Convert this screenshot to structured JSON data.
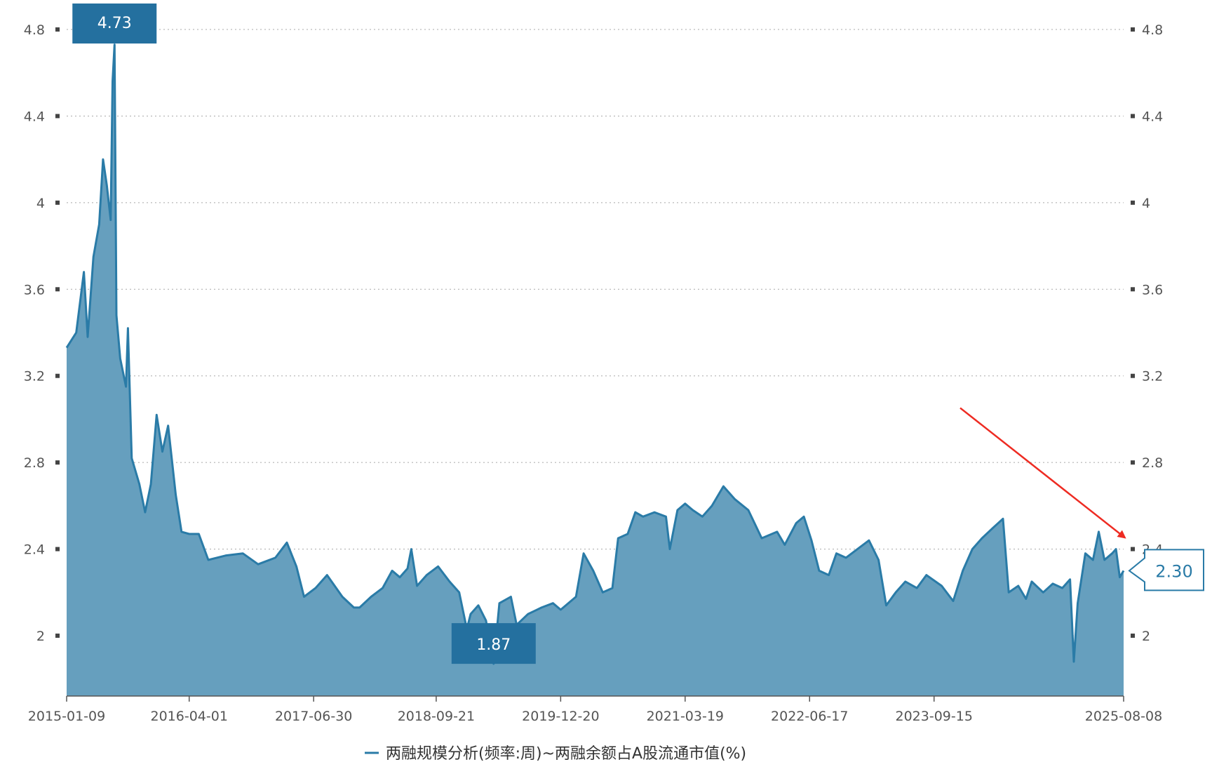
{
  "chart_data": {
    "type": "area",
    "title": "",
    "ylim": [
      1.72,
      4.85
    ],
    "y_ticks": [
      "2",
      "2.4",
      "2.8",
      "3.2",
      "3.6",
      "4",
      "4.4",
      "4.8"
    ],
    "x_tick_labels": [
      "2015-01-09",
      "2016-04-01",
      "2017-06-30",
      "2018-09-21",
      "2019-12-20",
      "2021-03-19",
      "2022-06-17",
      "2023-09-15",
      "2025-08-08"
    ],
    "grid": true,
    "dual_y_axis": true,
    "legend_position": "bottom-center",
    "series": [
      {
        "name": "两融规模分析(频率:周)~两融余额占A股流通市值(%)",
        "color": "#2a7ba7",
        "fill": "#669fbe",
        "points": [
          [
            "2015-01-09",
            3.33
          ],
          [
            "2015-02-13",
            3.4
          ],
          [
            "2015-03-13",
            3.68
          ],
          [
            "2015-03-27",
            3.38
          ],
          [
            "2015-04-17",
            3.75
          ],
          [
            "2015-05-08",
            3.9
          ],
          [
            "2015-05-22",
            4.2
          ],
          [
            "2015-06-05",
            4.08
          ],
          [
            "2015-06-19",
            3.92
          ],
          [
            "2015-06-26",
            4.56
          ],
          [
            "2015-07-03",
            4.73
          ],
          [
            "2015-07-10",
            3.48
          ],
          [
            "2015-07-24",
            3.28
          ],
          [
            "2015-08-14",
            3.15
          ],
          [
            "2015-08-21",
            3.42
          ],
          [
            "2015-09-04",
            2.82
          ],
          [
            "2015-10-02",
            2.7
          ],
          [
            "2015-10-23",
            2.57
          ],
          [
            "2015-11-13",
            2.7
          ],
          [
            "2015-12-04",
            3.02
          ],
          [
            "2015-12-25",
            2.85
          ],
          [
            "2016-01-15",
            2.97
          ],
          [
            "2016-02-12",
            2.65
          ],
          [
            "2016-03-04",
            2.48
          ],
          [
            "2016-04-01",
            2.47
          ],
          [
            "2016-05-06",
            2.47
          ],
          [
            "2016-06-10",
            2.35
          ],
          [
            "2016-08-12",
            2.37
          ],
          [
            "2016-10-14",
            2.38
          ],
          [
            "2016-12-09",
            2.33
          ],
          [
            "2017-02-10",
            2.36
          ],
          [
            "2017-03-24",
            2.43
          ],
          [
            "2017-04-28",
            2.32
          ],
          [
            "2017-05-26",
            2.18
          ],
          [
            "2017-07-07",
            2.22
          ],
          [
            "2017-08-18",
            2.28
          ],
          [
            "2017-10-13",
            2.18
          ],
          [
            "2017-11-24",
            2.13
          ],
          [
            "2017-12-15",
            2.13
          ],
          [
            "2018-01-26",
            2.18
          ],
          [
            "2018-03-09",
            2.22
          ],
          [
            "2018-04-13",
            2.3
          ],
          [
            "2018-05-11",
            2.27
          ],
          [
            "2018-06-08",
            2.31
          ],
          [
            "2018-06-22",
            2.4
          ],
          [
            "2018-07-13",
            2.23
          ],
          [
            "2018-08-17",
            2.28
          ],
          [
            "2018-09-28",
            2.32
          ],
          [
            "2018-11-09",
            2.25
          ],
          [
            "2018-12-14",
            2.2
          ],
          [
            "2019-01-11",
            2.03
          ],
          [
            "2019-01-25",
            2.1
          ],
          [
            "2019-02-22",
            2.14
          ],
          [
            "2019-03-22",
            2.07
          ],
          [
            "2019-04-19",
            1.87
          ],
          [
            "2019-05-10",
            2.15
          ],
          [
            "2019-06-21",
            2.18
          ],
          [
            "2019-07-12",
            2.05
          ],
          [
            "2019-08-23",
            2.1
          ],
          [
            "2019-10-11",
            2.13
          ],
          [
            "2019-11-22",
            2.15
          ],
          [
            "2019-12-20",
            2.12
          ],
          [
            "2020-02-14",
            2.18
          ],
          [
            "2020-03-13",
            2.38
          ],
          [
            "2020-04-17",
            2.3
          ],
          [
            "2020-05-22",
            2.2
          ],
          [
            "2020-06-26",
            2.22
          ],
          [
            "2020-07-17",
            2.45
          ],
          [
            "2020-08-21",
            2.47
          ],
          [
            "2020-09-18",
            2.57
          ],
          [
            "2020-10-16",
            2.55
          ],
          [
            "2020-11-27",
            2.57
          ],
          [
            "2021-01-08",
            2.55
          ],
          [
            "2021-01-22",
            2.4
          ],
          [
            "2021-02-19",
            2.58
          ],
          [
            "2021-03-19",
            2.61
          ],
          [
            "2021-04-16",
            2.58
          ],
          [
            "2021-05-21",
            2.55
          ],
          [
            "2021-06-25",
            2.6
          ],
          [
            "2021-08-06",
            2.69
          ],
          [
            "2021-09-17",
            2.63
          ],
          [
            "2021-11-05",
            2.58
          ],
          [
            "2021-12-24",
            2.45
          ],
          [
            "2022-02-18",
            2.48
          ],
          [
            "2022-03-18",
            2.42
          ],
          [
            "2022-04-29",
            2.52
          ],
          [
            "2022-05-27",
            2.55
          ],
          [
            "2022-06-24",
            2.44
          ],
          [
            "2022-07-22",
            2.3
          ],
          [
            "2022-08-26",
            2.28
          ],
          [
            "2022-09-23",
            2.38
          ],
          [
            "2022-10-28",
            2.36
          ],
          [
            "2022-12-09",
            2.4
          ],
          [
            "2023-01-20",
            2.44
          ],
          [
            "2023-02-24",
            2.35
          ],
          [
            "2023-03-24",
            2.14
          ],
          [
            "2023-04-28",
            2.2
          ],
          [
            "2023-06-02",
            2.25
          ],
          [
            "2023-07-14",
            2.22
          ],
          [
            "2023-08-18",
            2.28
          ],
          [
            "2023-10-13",
            2.23
          ],
          [
            "2023-11-24",
            2.16
          ],
          [
            "2023-12-29",
            2.3
          ],
          [
            "2024-02-02",
            2.4
          ],
          [
            "2024-03-08",
            2.45
          ],
          [
            "2024-04-19",
            2.5
          ],
          [
            "2024-05-24",
            2.54
          ],
          [
            "2024-06-14",
            2.2
          ],
          [
            "2024-07-19",
            2.23
          ],
          [
            "2024-08-16",
            2.17
          ],
          [
            "2024-09-06",
            2.25
          ],
          [
            "2024-10-18",
            2.2
          ],
          [
            "2024-11-22",
            2.24
          ],
          [
            "2024-12-27",
            2.22
          ],
          [
            "2025-01-24",
            2.26
          ],
          [
            "2025-02-07",
            1.88
          ],
          [
            "2025-02-21",
            2.15
          ],
          [
            "2025-03-21",
            2.38
          ],
          [
            "2025-04-18",
            2.35
          ],
          [
            "2025-05-09",
            2.48
          ],
          [
            "2025-05-30",
            2.35
          ],
          [
            "2025-06-27",
            2.38
          ],
          [
            "2025-07-11",
            2.4
          ],
          [
            "2025-07-25",
            2.27
          ],
          [
            "2025-08-08",
            2.3
          ]
        ]
      }
    ],
    "annotations": [
      {
        "label": "4.73",
        "date": "2015-07-03",
        "value": 4.73,
        "kind": "max"
      },
      {
        "label": "1.87",
        "date": "2019-04-19",
        "value": 1.87,
        "kind": "min"
      },
      {
        "label": "2.30",
        "date": "2025-08-08",
        "value": 2.3,
        "kind": "last"
      }
    ],
    "arrow": {
      "color": "#ee2b22",
      "points_to": "2025-08-08"
    }
  }
}
